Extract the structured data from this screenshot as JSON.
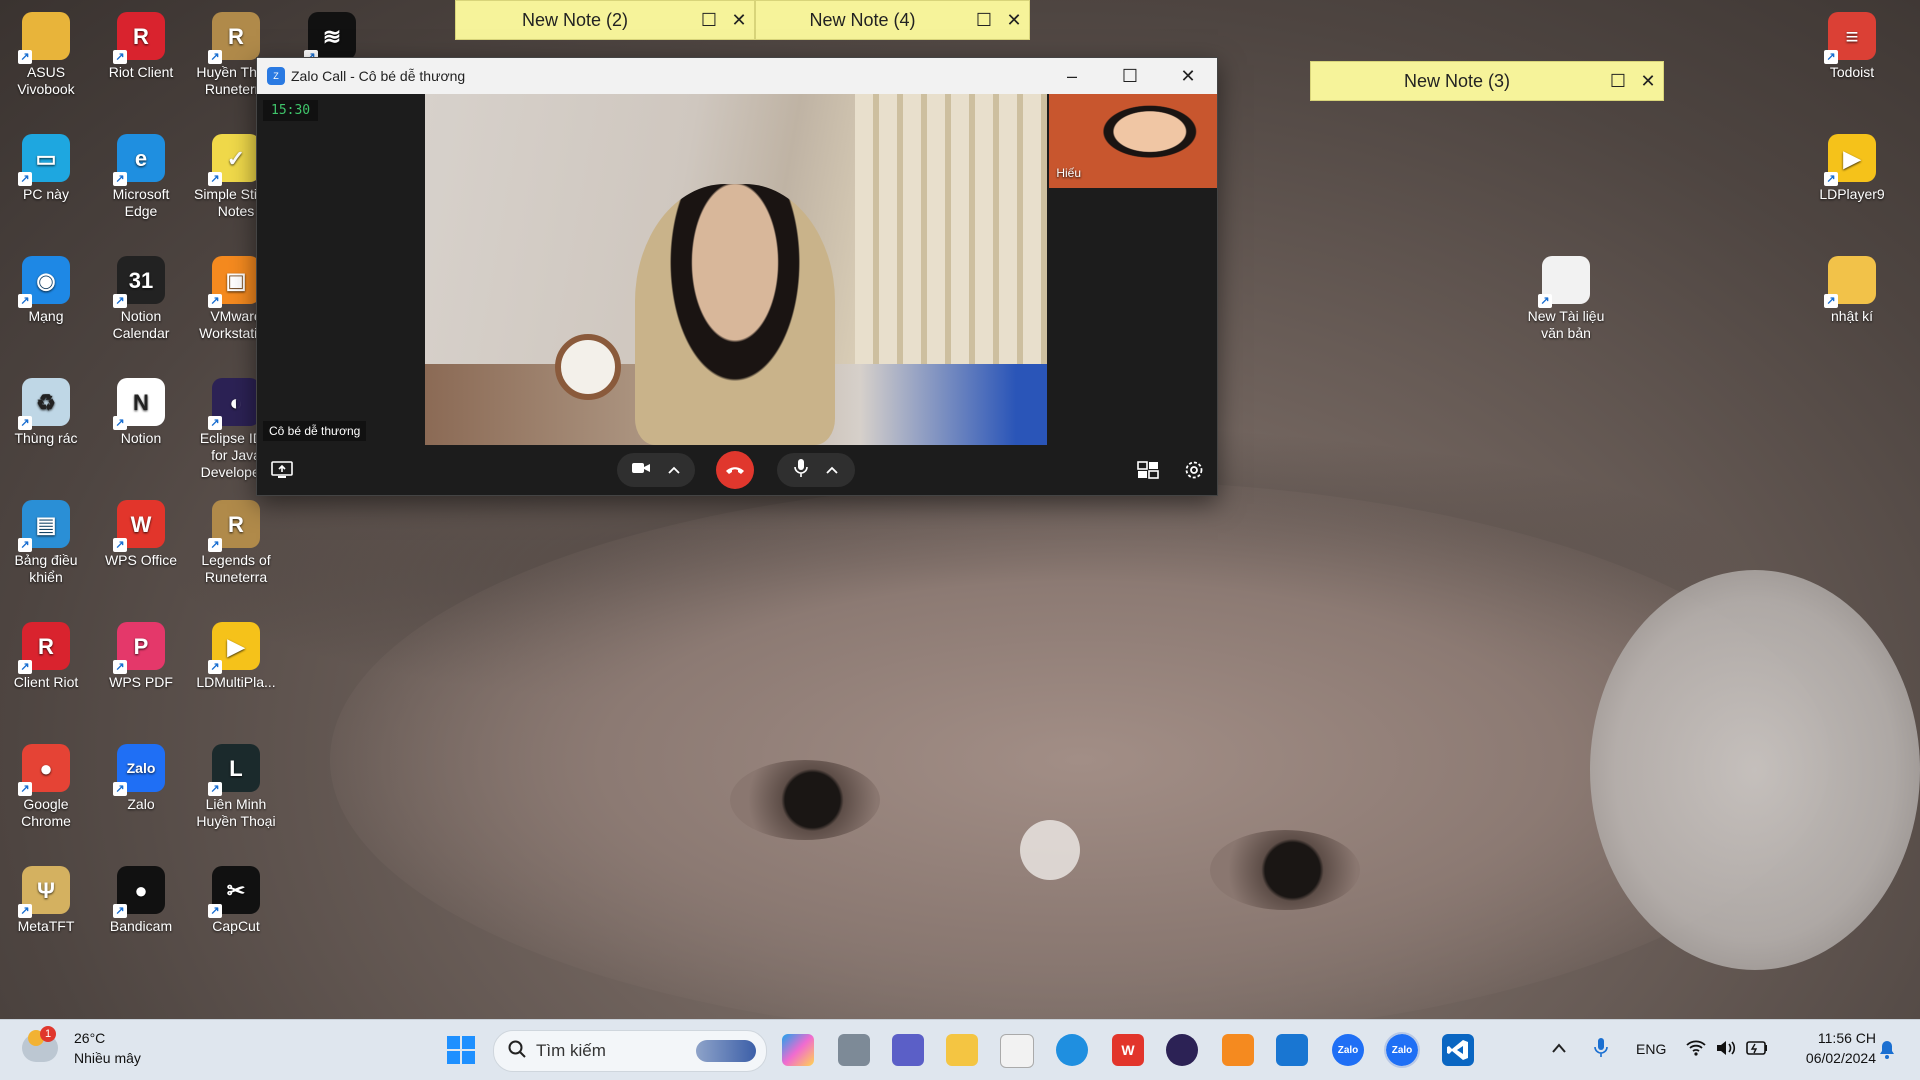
{
  "desktop_icons": [
    {
      "label": "ASUS Vivobook",
      "icon": "folder-icon",
      "color": "#e8b43a"
    },
    {
      "label": "Riot Client",
      "icon": "riot-client-icon",
      "color": "#d9232e"
    },
    {
      "label": "Huyền Thoại Runeterra",
      "icon": "runeterra-icon",
      "color": "#b08a4a"
    },
    {
      "label": "",
      "icon": "app-icon",
      "color": "#111111"
    },
    {
      "label": "PC này",
      "icon": "pc-icon",
      "color": "#1ea7e0"
    },
    {
      "label": "Microsoft Edge",
      "icon": "edge-icon",
      "color": "#1f8fe0"
    },
    {
      "label": "Simple Sticky Notes",
      "icon": "sticky-notes-icon",
      "color": "#f0d94a"
    },
    {
      "label": "Mạng",
      "icon": "network-icon",
      "color": "#1e88e5"
    },
    {
      "label": "Notion Calendar",
      "icon": "calendar-icon",
      "color": "#222222"
    },
    {
      "label": "VMware Workstation",
      "icon": "vmware-icon",
      "color": "#f58a1f"
    },
    {
      "label": "Thùng rác",
      "icon": "recycle-bin-icon",
      "color": "#bfd7e6"
    },
    {
      "label": "Notion",
      "icon": "notion-icon",
      "color": "#ffffff"
    },
    {
      "label": "Eclipse IDE for Java Developers",
      "icon": "eclipse-icon",
      "color": "#2c2255"
    },
    {
      "label": "Bảng điều khiển",
      "icon": "control-panel-icon",
      "color": "#2a8fd6"
    },
    {
      "label": "WPS Office",
      "icon": "wps-office-icon",
      "color": "#e2352b"
    },
    {
      "label": "Legends of Runeterra",
      "icon": "legends-runeterra-icon",
      "color": "#b08a4a"
    },
    {
      "label": "Client Riot",
      "icon": "riot-client-icon",
      "color": "#d9232e"
    },
    {
      "label": "WPS PDF",
      "icon": "wps-pdf-icon",
      "color": "#e4386a"
    },
    {
      "label": "LDMultiPla...",
      "icon": "ldmultiplayer-icon",
      "color": "#f5c21a"
    },
    {
      "label": "Google Chrome",
      "icon": "chrome-icon",
      "color": "#e54335"
    },
    {
      "label": "Zalo",
      "icon": "zalo-icon",
      "color": "#1f6ff5"
    },
    {
      "label": "Liên Minh Huyền Thoại",
      "icon": "league-icon",
      "color": "#1b2a2c"
    },
    {
      "label": "MetaTFT",
      "icon": "metatft-icon",
      "color": "#d4b160"
    },
    {
      "label": "Bandicam",
      "icon": "bandicam-icon",
      "color": "#111111"
    },
    {
      "label": "CapCut",
      "icon": "capcut-icon",
      "color": "#111111"
    },
    {
      "label": "Todoist",
      "icon": "todoist-icon",
      "color": "#db4035"
    },
    {
      "label": "LDPlayer9",
      "icon": "ldplayer-icon",
      "color": "#f5c21a"
    },
    {
      "label": "New Tài liệu văn bản",
      "icon": "text-document-icon",
      "color": "#f2f2f2"
    },
    {
      "label": "nhật kí",
      "icon": "folder-icon",
      "color": "#f2c249"
    }
  ],
  "notes": [
    {
      "title": "New Note (2)"
    },
    {
      "title": "New Note (4)"
    },
    {
      "title": "New Note (3)"
    }
  ],
  "call": {
    "title": "Zalo Call - Cô bé dễ thương",
    "timer": "15:30",
    "caller_name": "Cô bé dễ thương",
    "self_name": "Hiếu"
  },
  "taskbar": {
    "weather_temp": "26°C",
    "weather_desc": "Nhiều mây",
    "weather_badge": "1",
    "search_placeholder": "Tìm kiếm",
    "language": "ENG",
    "time": "11:56 CH",
    "date": "06/02/2024"
  },
  "colors": {
    "note_bg": "#f6f39a",
    "end_call": "#e0372d",
    "timer_text": "#3fc46a",
    "taskbar_bg": "#dfe6ee"
  }
}
